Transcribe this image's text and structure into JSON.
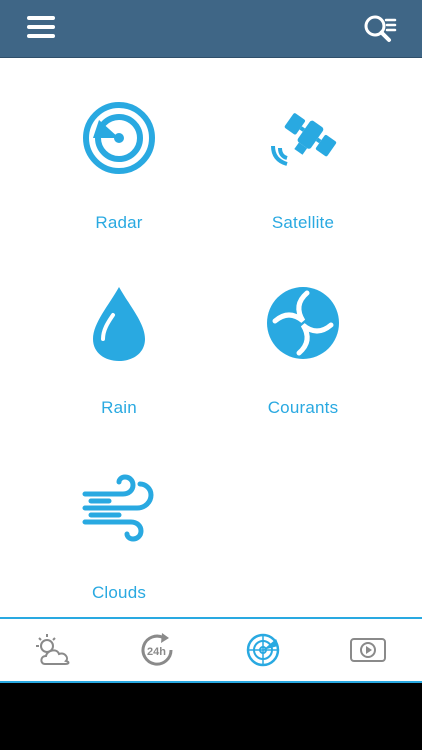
{
  "header": {
    "menu_icon": "hamburger-menu-icon",
    "search_icon": "search-list-icon",
    "background_color": "#3f6686"
  },
  "tiles": [
    {
      "label": "Radar",
      "icon": "radar-icon"
    },
    {
      "label": "Satellite",
      "icon": "satellite-icon"
    },
    {
      "label": "Rain",
      "icon": "raindrop-icon"
    },
    {
      "label": "Courants",
      "icon": "currents-icon"
    },
    {
      "label": "Clouds",
      "icon": "wind-icon"
    }
  ],
  "bottom_nav": {
    "tabs": [
      {
        "icon": "sun-cloud-icon",
        "active": false
      },
      {
        "icon": "24h-icon",
        "text": "24h",
        "active": false
      },
      {
        "icon": "radar-globe-icon",
        "active": true
      },
      {
        "icon": "video-play-icon",
        "active": false
      }
    ],
    "accent_color": "#29a9e1"
  }
}
